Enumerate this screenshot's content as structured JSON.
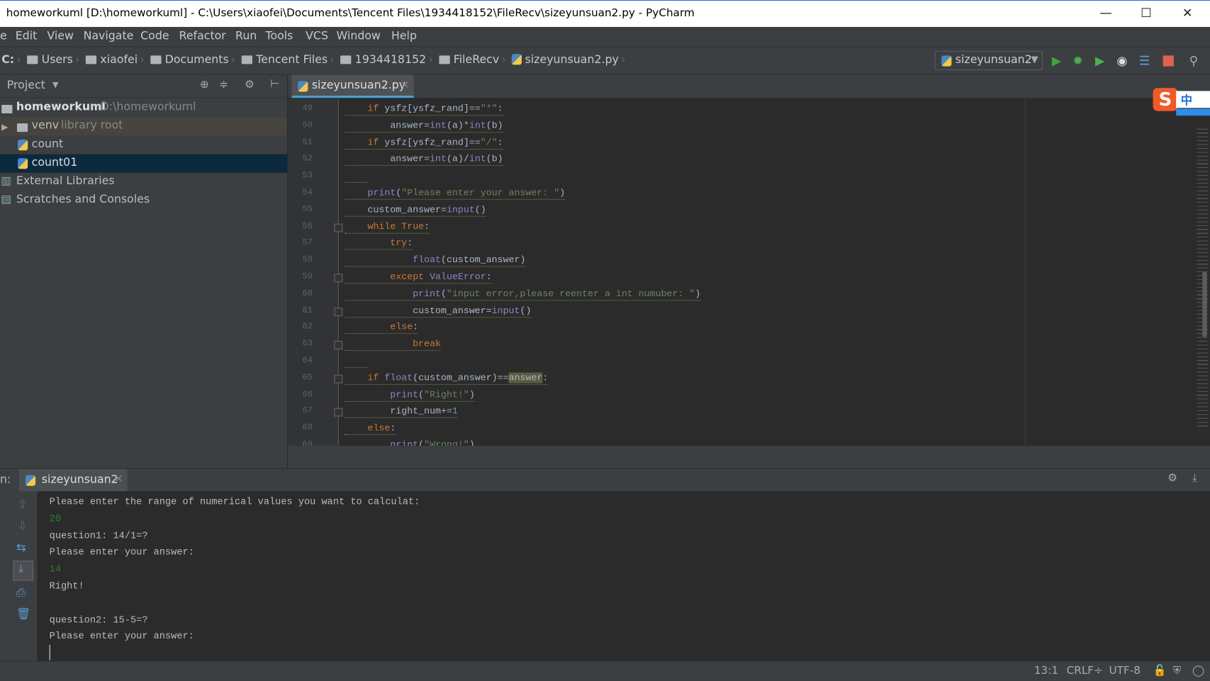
{
  "window": {
    "title": "homeworkuml [D:\\homeworkuml] - C:\\Users\\xiaofei\\Documents\\Tencent Files\\1934418152\\FileRecv\\sizeyunsuan2.py - PyCharm",
    "minimize": "—",
    "maximize": "☐",
    "close": "✕"
  },
  "menu": [
    "e",
    "Edit",
    "View",
    "Navigate",
    "Code",
    "Refactor",
    "Run",
    "Tools",
    "VCS",
    "Window",
    "Help"
  ],
  "breadcrumb": {
    "drive": "C:",
    "items": [
      "Users",
      "xiaofei",
      "Documents",
      "Tencent Files",
      "1934418152",
      "FileRecv"
    ],
    "file": "sizeyunsuan2.py"
  },
  "toolbar": {
    "run_config": "sizeyunsuan2",
    "icons": [
      "run-icon",
      "debug-icon",
      "coverage-icon",
      "profile-icon",
      "concurrency-icon",
      "stop-icon",
      "search-icon"
    ]
  },
  "project": {
    "title": "Project",
    "tree": [
      {
        "label": "homeworkuml",
        "hint": "D:\\homeworkuml",
        "icon": "folder-icon"
      },
      {
        "label": "venv",
        "hint": "library root",
        "icon": "folder-icon"
      },
      {
        "label": "count",
        "hint": "",
        "icon": "python-file-icon"
      },
      {
        "label": "count01",
        "hint": "",
        "icon": "python-file-icon",
        "selected": true
      },
      {
        "label": "External Libraries",
        "hint": "",
        "icon": "libraries-icon"
      },
      {
        "label": "Scratches and Consoles",
        "hint": "",
        "icon": "scratches-icon"
      }
    ]
  },
  "editor": {
    "tab": "sizeyunsuan2.py",
    "tab_close": "×",
    "lines": [
      {
        "n": "49",
        "t": [
          [
            "    ",
            "pl"
          ],
          [
            "if ",
            "kw"
          ],
          [
            "ysfz[ysfz_rand]==",
            "pl"
          ],
          [
            "\"*\"",
            "str"
          ],
          [
            ":",
            "pl"
          ]
        ]
      },
      {
        "n": "50",
        "t": [
          [
            "        answer=",
            "pl"
          ],
          [
            "int",
            "bi"
          ],
          [
            "(a)*",
            "pl"
          ],
          [
            "int",
            "bi"
          ],
          [
            "(b)",
            "pl"
          ]
        ]
      },
      {
        "n": "51",
        "t": [
          [
            "    ",
            "pl"
          ],
          [
            "if ",
            "kw"
          ],
          [
            "ysfz[ysfz_rand]==",
            "pl"
          ],
          [
            "\"/\"",
            "str"
          ],
          [
            ":",
            "pl"
          ]
        ]
      },
      {
        "n": "52",
        "t": [
          [
            "        answer=",
            "pl"
          ],
          [
            "int",
            "bi"
          ],
          [
            "(a)/",
            "pl"
          ],
          [
            "int",
            "bi"
          ],
          [
            "(b)",
            "pl"
          ]
        ]
      },
      {
        "n": "53",
        "t": [
          [
            "    ",
            "pl"
          ]
        ]
      },
      {
        "n": "54",
        "t": [
          [
            "    ",
            "pl"
          ],
          [
            "print",
            "bi"
          ],
          [
            "(",
            "pl"
          ],
          [
            "\"Please enter your answer: \"",
            "str"
          ],
          [
            ")",
            "pl"
          ]
        ]
      },
      {
        "n": "55",
        "t": [
          [
            "    custom_answer=",
            "pl"
          ],
          [
            "input",
            "bi"
          ],
          [
            "()",
            "pl"
          ]
        ]
      },
      {
        "n": "56",
        "t": [
          [
            "    ",
            "pl"
          ],
          [
            "while True",
            "kw"
          ],
          [
            ":",
            "pl"
          ]
        ],
        "fold": true
      },
      {
        "n": "57",
        "t": [
          [
            "        ",
            "pl"
          ],
          [
            "try",
            "kw"
          ],
          [
            ":",
            "pl"
          ]
        ]
      },
      {
        "n": "58",
        "t": [
          [
            "            ",
            "pl"
          ],
          [
            "float",
            "bi"
          ],
          [
            "(custom_answer)",
            "pl"
          ]
        ]
      },
      {
        "n": "59",
        "t": [
          [
            "        ",
            "pl"
          ],
          [
            "except ",
            "kw"
          ],
          [
            "ValueError",
            "bi"
          ],
          [
            ":",
            "pl"
          ]
        ],
        "fold": true
      },
      {
        "n": "60",
        "t": [
          [
            "            ",
            "pl"
          ],
          [
            "print",
            "bi"
          ],
          [
            "(",
            "pl"
          ],
          [
            "\"input error,please reenter a int numuber: \"",
            "str"
          ],
          [
            ")",
            "pl"
          ]
        ]
      },
      {
        "n": "61",
        "t": [
          [
            "            custom_answer=",
            "pl"
          ],
          [
            "input",
            "bi"
          ],
          [
            "()",
            "pl"
          ]
        ],
        "fold": true
      },
      {
        "n": "62",
        "t": [
          [
            "        ",
            "pl"
          ],
          [
            "else",
            "kw"
          ],
          [
            ":",
            "pl"
          ]
        ]
      },
      {
        "n": "63",
        "t": [
          [
            "            ",
            "pl"
          ],
          [
            "break",
            "kw"
          ]
        ],
        "fold": true
      },
      {
        "n": "64",
        "t": [
          [
            "    ",
            "pl"
          ]
        ]
      },
      {
        "n": "65",
        "t": [
          [
            "    ",
            "pl"
          ],
          [
            "if ",
            "kw"
          ],
          [
            "float",
            "bi"
          ],
          [
            "(custom_answer)==",
            "pl"
          ],
          [
            "answer",
            "hl"
          ],
          [
            ":",
            "pl"
          ]
        ],
        "fold": true
      },
      {
        "n": "66",
        "t": [
          [
            "        ",
            "pl"
          ],
          [
            "print",
            "bi"
          ],
          [
            "(",
            "pl"
          ],
          [
            "\"Right!\"",
            "str"
          ],
          [
            ")",
            "pl"
          ]
        ]
      },
      {
        "n": "67",
        "t": [
          [
            "        right_num+=",
            "pl"
          ],
          [
            "1",
            "num"
          ]
        ],
        "fold": true
      },
      {
        "n": "68",
        "t": [
          [
            "    ",
            "pl"
          ],
          [
            "else",
            "kw"
          ],
          [
            ":",
            "pl"
          ]
        ]
      },
      {
        "n": "69",
        "t": [
          [
            "        ",
            "pl"
          ],
          [
            "print",
            "bi"
          ],
          [
            "(",
            "pl"
          ],
          [
            "\"Wrong!\"",
            "str"
          ],
          [
            ")",
            "pl"
          ]
        ]
      }
    ]
  },
  "run": {
    "label": "n:",
    "tab": "sizeyunsuan2",
    "tab_close": "×",
    "output": [
      {
        "text": "Please enter the range of numerical values you want to calculat:",
        "input": false
      },
      {
        "text": "20",
        "input": true
      },
      {
        "text": "question1: 14/1=?",
        "input": false
      },
      {
        "text": "Please enter your answer:",
        "input": false
      },
      {
        "text": "14",
        "input": true
      },
      {
        "text": "Right!",
        "input": false
      },
      {
        "text": "",
        "input": false
      },
      {
        "text": "question2: 15-5=?",
        "input": false
      },
      {
        "text": "Please enter your answer:",
        "input": false
      }
    ]
  },
  "status": {
    "position": "13:1",
    "line_sep": "CRLF÷",
    "encoding": "UTF-8"
  },
  "ime": {
    "logo": "S",
    "mode": "中"
  },
  "colors": {
    "keyword": "#cc7832",
    "builtin": "#8888c6",
    "string": "#6a8759",
    "number": "#6897bb",
    "selection": "#0d293e",
    "accent": "#4a9fd4"
  }
}
